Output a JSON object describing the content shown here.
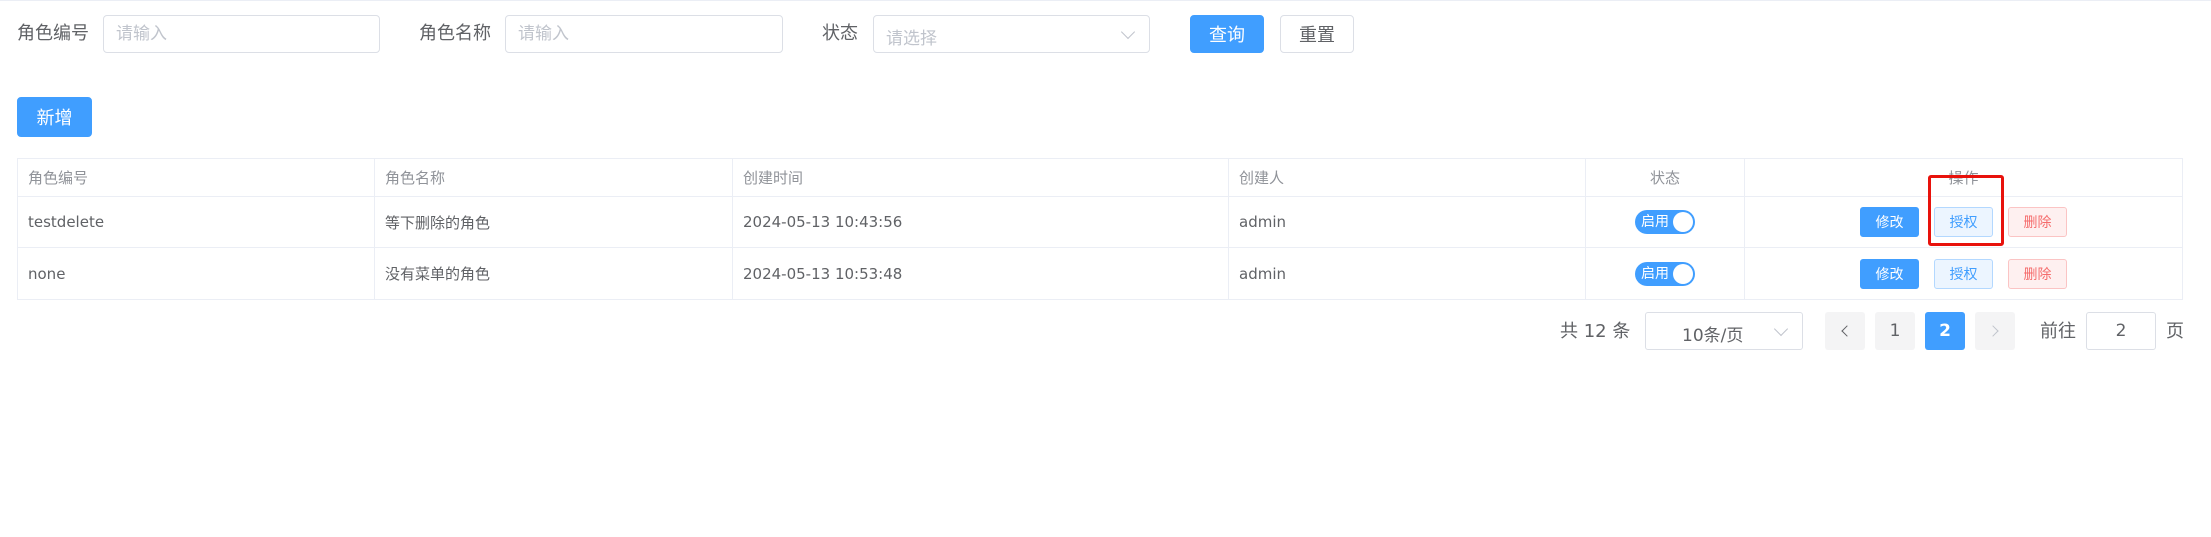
{
  "search": {
    "role_code_label": "角色编号",
    "role_code_placeholder": "请输入",
    "role_name_label": "角色名称",
    "role_name_placeholder": "请输入",
    "status_label": "状态",
    "status_placeholder": "请选择",
    "query_label": "查询",
    "reset_label": "重置"
  },
  "toolbar": {
    "add_label": "新增"
  },
  "table": {
    "columns": [
      "角色编号",
      "角色名称",
      "创建时间",
      "创建人",
      "状态",
      "操作"
    ],
    "rows": [
      {
        "code": "testdelete",
        "name": "等下删除的角色",
        "created_at": "2024-05-13 10:43:56",
        "creator": "admin",
        "status": "启用",
        "enabled": true
      },
      {
        "code": "none",
        "name": "没有菜单的角色",
        "created_at": "2024-05-13 10:53:48",
        "creator": "admin",
        "status": "启用",
        "enabled": true
      }
    ],
    "actions": {
      "edit": "修改",
      "grant": "授权",
      "delete": "删除"
    }
  },
  "pagination": {
    "total_text": "共 12 条",
    "page_size": "10条/页",
    "pages": [
      "1",
      "2"
    ],
    "current_page": "2",
    "goto_label": "前往",
    "goto_value": "2",
    "page_unit": "页"
  },
  "colors": {
    "primary": "#409eff",
    "danger": "#f56c6c",
    "highlight": "#e8120c"
  }
}
